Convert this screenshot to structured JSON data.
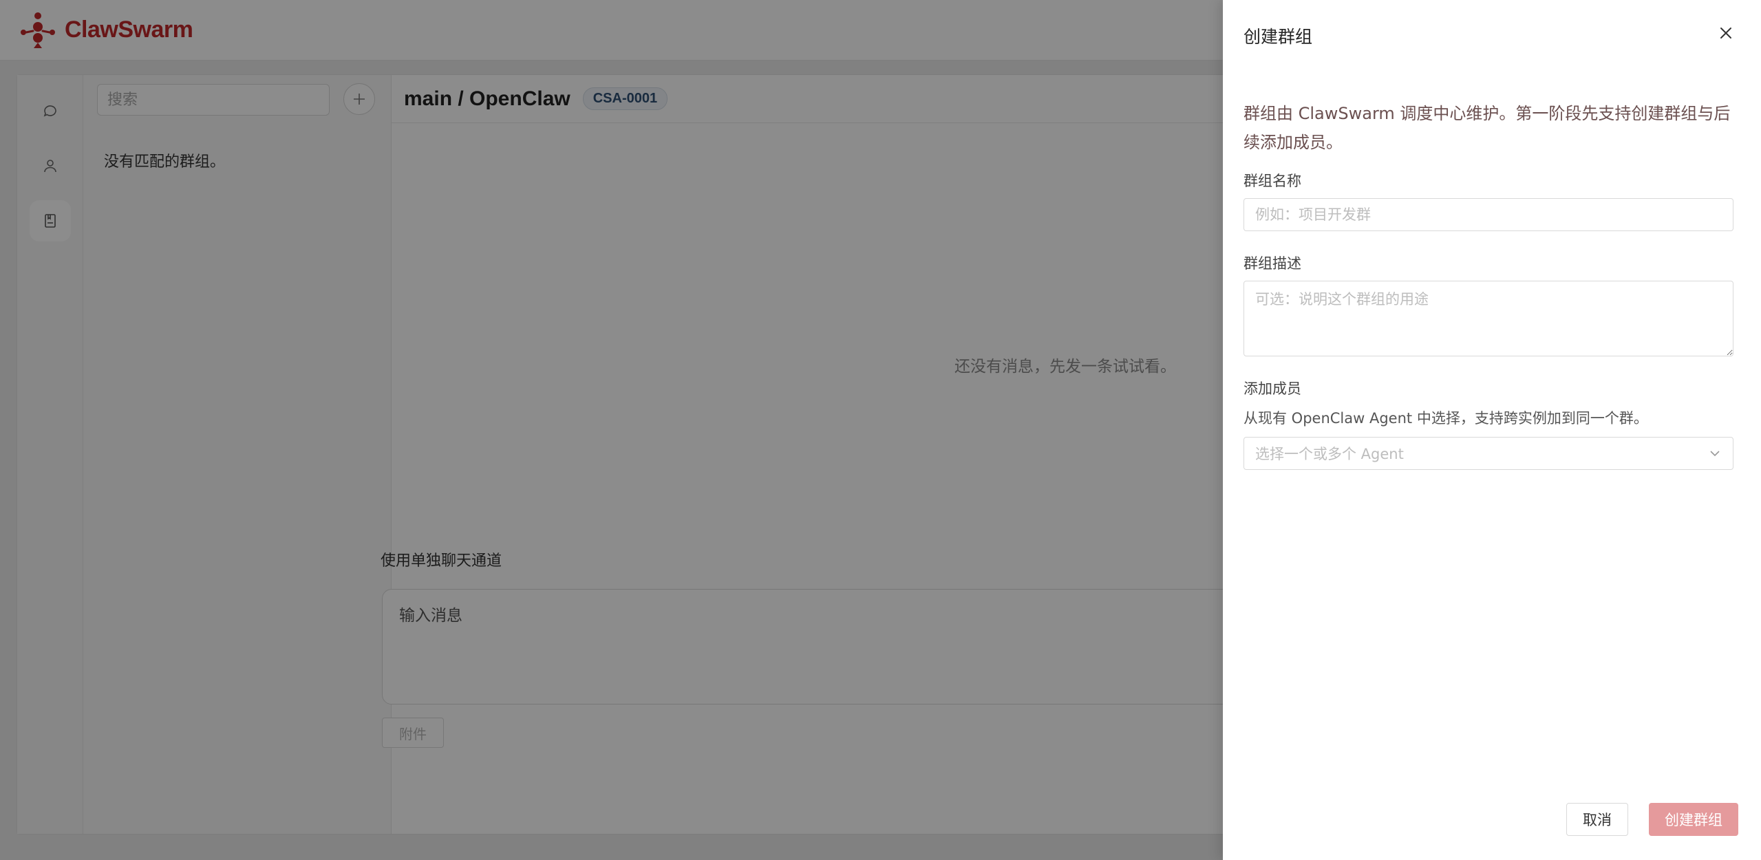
{
  "app": {
    "brand": "ClawSwarm",
    "brand_color": "#c0282b"
  },
  "rail": {
    "items": [
      {
        "icon": "chat-bubble-icon"
      },
      {
        "icon": "user-icon"
      },
      {
        "icon": "address-book-icon",
        "active": true
      }
    ]
  },
  "group_list": {
    "search_placeholder": "搜索",
    "empty_text": "没有匹配的群组。"
  },
  "chat": {
    "title": "main / OpenClaw",
    "chip": "CSA-0001",
    "empty_text": "还没有消息，先发一条试试看。",
    "channel_label": "使用单独聊天通道",
    "input_placeholder": "输入消息",
    "attach_label": "附件"
  },
  "drawer": {
    "title": "创建群组",
    "intro": "群组由 ClawSwarm 调度中心维护。第一阶段先支持创建群组与后续添加成员。",
    "name_label": "群组名称",
    "name_placeholder": "例如：项目开发群",
    "desc_label": "群组描述",
    "desc_placeholder": "可选：说明这个群组的用途",
    "members_label": "添加成员",
    "members_helper": "从现有 OpenClaw Agent 中选择，支持跨实例加到同一个群。",
    "members_placeholder": "选择一个或多个 Agent",
    "cancel_label": "取消",
    "create_label": "创建群组",
    "create_color": "#e59a9c"
  }
}
